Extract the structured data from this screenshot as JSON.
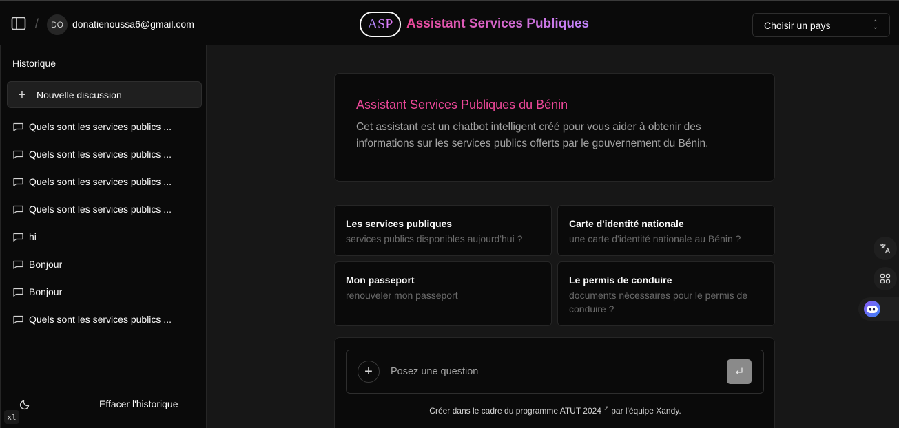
{
  "header": {
    "avatar_initials": "DO",
    "user_email": "donatienoussa6@gmail.com",
    "logo_text": "ASP",
    "app_title": "Assistant Services Publiques",
    "country_select_value": "Choisir un pays"
  },
  "sidebar": {
    "heading": "Historique",
    "new_chat_label": "Nouvelle discussion",
    "history": [
      "Quels sont les services publics ...",
      "Quels sont les services publics ...",
      "Quels sont les services publics ...",
      "Quels sont les services publics ...",
      "hi",
      "Bonjour",
      "Bonjour",
      "Quels sont les services publics ..."
    ],
    "clear_history_label": "Effacer l'historique",
    "breakpoint_badge": "xl"
  },
  "main": {
    "intro_title": "Assistant Services Publiques du Bénin",
    "intro_description": "Cet assistant est un chatbot intelligent créé pour vous aider à obtenir des informations sur les services publics offerts par le gouvernement du Bénin.",
    "suggestions": [
      {
        "title": "Les services publiques",
        "subtitle": "services publics disponibles aujourd'hui ?"
      },
      {
        "title": "Carte d'identité nationale",
        "subtitle": "une carte d'identité nationale au Bénin ?"
      },
      {
        "title": "Mon passeport",
        "subtitle": "renouveler mon passeport"
      },
      {
        "title": "Le permis de conduire",
        "subtitle": "documents nécessaires pour le permis de conduire ?"
      }
    ],
    "composer": {
      "placeholder": "Posez une question",
      "value": ""
    },
    "footer": {
      "prefix": "Créer dans le cadre du programme ATUT 2024",
      "link_marker": "↗",
      "suffix": "par l'équipe Xandy."
    }
  },
  "icons": {
    "sidebar_toggle": "sidebar-panel-icon",
    "chat": "message-square-icon",
    "theme": "moon-icon",
    "translate": "translate-icon",
    "apps": "grid-icon",
    "assistant": "bot-icon"
  },
  "colors": {
    "accent_pink": "#ec4899",
    "accent_purple": "#c084fc",
    "background": "#171717",
    "panel": "#0a0a0a"
  }
}
